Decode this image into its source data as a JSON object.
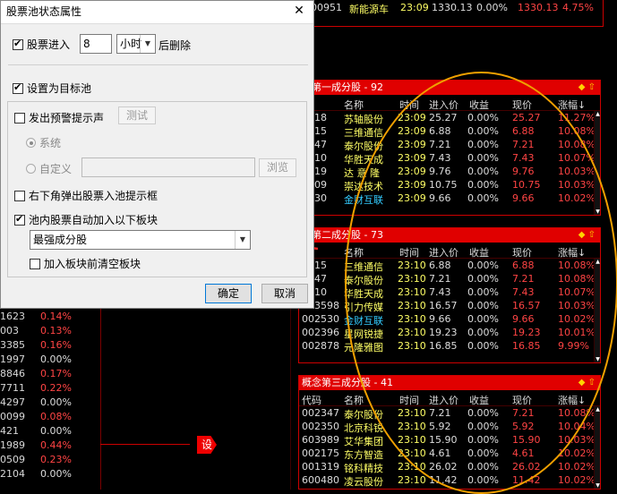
{
  "top_strip": {
    "code": "600951",
    "name": "新能源车",
    "time": "23:09",
    "in_price": "1330.13",
    "yield": "0.00%",
    "price": "1330.13",
    "chg": "4.75%",
    "left_code": "551709"
  },
  "left_list": [
    {
      "code": "1623",
      "pct": "0.14%",
      "color": "#ff4444"
    },
    {
      "code": "003",
      "pct": "0.13%",
      "color": "#ff4444"
    },
    {
      "code": "3385",
      "pct": "0.16%",
      "color": "#ff4444"
    },
    {
      "code": "1997",
      "pct": "0.00%",
      "color": "#dddddd"
    },
    {
      "code": "8846",
      "pct": "0.17%",
      "color": "#ff4444"
    },
    {
      "code": "7711",
      "pct": "0.22%",
      "color": "#ff4444"
    },
    {
      "code": "4297",
      "pct": "0.00%",
      "color": "#dddddd"
    },
    {
      "code": "0099",
      "pct": "0.08%",
      "color": "#ff4444"
    },
    {
      "code": "421",
      "pct": "0.00%",
      "color": "#dddddd"
    },
    {
      "code": "1989",
      "pct": "0.44%",
      "color": "#ff4444"
    },
    {
      "code": "0509",
      "pct": "0.23%",
      "color": "#ff4444"
    },
    {
      "code": "2104",
      "pct": "0.00%",
      "color": "#dddddd"
    }
  ],
  "panels": [
    {
      "title": "念第一成分股 - 92",
      "headers": [
        "码",
        "名称",
        "时间",
        "进入价",
        "收益",
        "现价",
        "涨幅↓"
      ],
      "rows": [
        {
          "code": "0418",
          "name": "苏轴股份",
          "time": "23:09",
          "in": "25.27",
          "yield": "0.00%",
          "price": "25.27",
          "chg": "11.27%",
          "cyan": false
        },
        {
          "code": "2115",
          "name": "三维通信",
          "time": "23:09",
          "in": "6.88",
          "yield": "0.00%",
          "price": "6.88",
          "chg": "10.08%",
          "cyan": false
        },
        {
          "code": "2347",
          "name": "泰尔股份",
          "time": "23:09",
          "in": "7.21",
          "yield": "0.00%",
          "price": "7.21",
          "chg": "10.08%",
          "cyan": false
        },
        {
          "code": "0410",
          "name": "华胜天成",
          "time": "23:09",
          "in": "7.43",
          "yield": "0.00%",
          "price": "7.43",
          "chg": "10.07%",
          "cyan": false
        },
        {
          "code": "0719",
          "name": "达 意 隆",
          "time": "23:09",
          "in": "9.76",
          "yield": "0.00%",
          "price": "9.76",
          "chg": "10.03%",
          "cyan": false
        },
        {
          "code": "2809",
          "name": "崇达技术",
          "time": "23:09",
          "in": "10.75",
          "yield": "0.00%",
          "price": "10.75",
          "chg": "10.03%",
          "cyan": false
        },
        {
          "code": "2530",
          "name": "金财互联",
          "time": "23:09",
          "in": "9.66",
          "yield": "0.00%",
          "price": "9.66",
          "chg": "10.02%",
          "cyan": true
        }
      ]
    },
    {
      "title": "念第二成分股 - 73",
      "headers": [
        "码",
        "名称",
        "时间",
        "进入价",
        "收益",
        "现价",
        "涨幅↓"
      ],
      "rows": [
        {
          "code": "2115",
          "name": "三维通信",
          "time": "23:10",
          "in": "6.88",
          "yield": "0.00%",
          "price": "6.88",
          "chg": "10.08%",
          "cyan": false
        },
        {
          "code": "2347",
          "name": "泰尔股份",
          "time": "23:10",
          "in": "7.21",
          "yield": "0.00%",
          "price": "7.21",
          "chg": "10.08%",
          "cyan": false
        },
        {
          "code": "0410",
          "name": "华胜天成",
          "time": "23:10",
          "in": "7.43",
          "yield": "0.00%",
          "price": "7.43",
          "chg": "10.07%",
          "cyan": false
        },
        {
          "code": "603598",
          "name": "引力传媒",
          "time": "23:10",
          "in": "16.57",
          "yield": "0.00%",
          "price": "16.57",
          "chg": "10.03%",
          "cyan": false
        },
        {
          "code": "002530",
          "name": "金财互联",
          "time": "23:10",
          "in": "9.66",
          "yield": "0.00%",
          "price": "9.66",
          "chg": "10.02%",
          "cyan": true
        },
        {
          "code": "002396",
          "name": "星网锐捷",
          "time": "23:10",
          "in": "19.23",
          "yield": "0.00%",
          "price": "19.23",
          "chg": "10.01%",
          "cyan": false
        },
        {
          "code": "002878",
          "name": "元隆雅图",
          "time": "23:10",
          "in": "16.85",
          "yield": "0.00%",
          "price": "16.85",
          "chg": "9.99%",
          "cyan": false
        }
      ]
    },
    {
      "title": "概念第三成分股 - 41",
      "headers": [
        "代码",
        "名称",
        "时间",
        "进入价",
        "收益",
        "现价",
        "涨幅↓"
      ],
      "rows": [
        {
          "code": "002347",
          "name": "泰尔股份",
          "time": "23:10",
          "in": "7.21",
          "yield": "0.00%",
          "price": "7.21",
          "chg": "10.08%",
          "cyan": false
        },
        {
          "code": "002350",
          "name": "北京科锐",
          "time": "23:10",
          "in": "5.92",
          "yield": "0.00%",
          "price": "5.92",
          "chg": "10.04%",
          "cyan": false
        },
        {
          "code": "603989",
          "name": "艾华集团",
          "time": "23:10",
          "in": "15.90",
          "yield": "0.00%",
          "price": "15.90",
          "chg": "10.03%",
          "cyan": false
        },
        {
          "code": "002175",
          "name": "东方智造",
          "time": "23:10",
          "in": "4.61",
          "yield": "0.00%",
          "price": "4.61",
          "chg": "10.02%",
          "cyan": false
        },
        {
          "code": "001319",
          "name": "铭科精技",
          "time": "23:10",
          "in": "26.02",
          "yield": "0.00%",
          "price": "26.02",
          "chg": "10.02%",
          "cyan": false
        },
        {
          "code": "600480",
          "name": "凌云股份",
          "time": "23:10",
          "in": "11.42",
          "yield": "0.00%",
          "price": "11.42",
          "chg": "10.02%",
          "cyan": false
        }
      ]
    }
  ],
  "panel_controls": "◆ ⇧",
  "set_marker": "设",
  "dialog": {
    "title": "股票池状态属性",
    "close_icon": "✕",
    "stock_enter_label": "股票进入",
    "stock_enter_value": "8",
    "unit_value": "小时",
    "after_delete_label": "后删除",
    "set_target_label": "设置为目标池",
    "alert_sound_label": "发出预警提示声",
    "test_button": "测试",
    "system_label": "系统",
    "custom_label": "自定义",
    "browse_button": "浏览",
    "popup_label": "右下角弹出股票入池提示框",
    "auto_add_label": "池内股票自动加入以下板块",
    "block_value": "最强成分股",
    "clear_label": "加入板块前清空板块",
    "ok_button": "确定",
    "cancel_button": "取消"
  }
}
